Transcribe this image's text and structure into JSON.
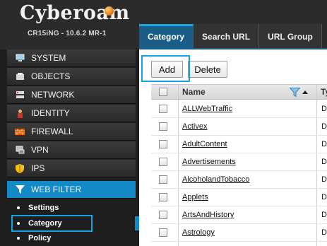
{
  "header": {
    "logo": "Cyberoam",
    "model": "CR15iNG - 10.6.2 MR-1"
  },
  "tabs": [
    {
      "label": "Category",
      "active": true
    },
    {
      "label": "Search URL",
      "active": false
    },
    {
      "label": "URL Group",
      "active": false
    }
  ],
  "sidebar": {
    "items": [
      {
        "label": "SYSTEM",
        "icon": "monitor-icon"
      },
      {
        "label": "OBJECTS",
        "icon": "objects-icon"
      },
      {
        "label": "NETWORK",
        "icon": "network-icon"
      },
      {
        "label": "IDENTITY",
        "icon": "identity-icon"
      },
      {
        "label": "FIREWALL",
        "icon": "firewall-icon"
      },
      {
        "label": "VPN",
        "icon": "vpn-icon"
      },
      {
        "label": "IPS",
        "icon": "shield-icon"
      },
      {
        "label": "WEB FILTER",
        "icon": "funnel-icon",
        "active": true
      }
    ],
    "subitems": [
      {
        "label": "Settings"
      },
      {
        "label": "Category",
        "active": true
      },
      {
        "label": "Policy"
      }
    ]
  },
  "toolbar": {
    "add_label": "Add",
    "delete_label": "Delete"
  },
  "table": {
    "columns": [
      "Name",
      "Ty"
    ],
    "rows": [
      {
        "name": "ALLWebTraffic",
        "type": "D"
      },
      {
        "name": "Activex",
        "type": "D"
      },
      {
        "name": "AdultContent",
        "type": "D"
      },
      {
        "name": "Advertisements",
        "type": "D"
      },
      {
        "name": "AlcoholandTobacco",
        "type": "D"
      },
      {
        "name": "Applets",
        "type": "D"
      },
      {
        "name": "ArtsAndHistory",
        "type": "D"
      },
      {
        "name": "Astrology",
        "type": "D"
      }
    ]
  },
  "colors": {
    "header_bg": "#2b2b2b",
    "tab_active": "#1a5d86",
    "sidebar_active": "#1389c6",
    "highlight_box": "#12a4e0"
  }
}
